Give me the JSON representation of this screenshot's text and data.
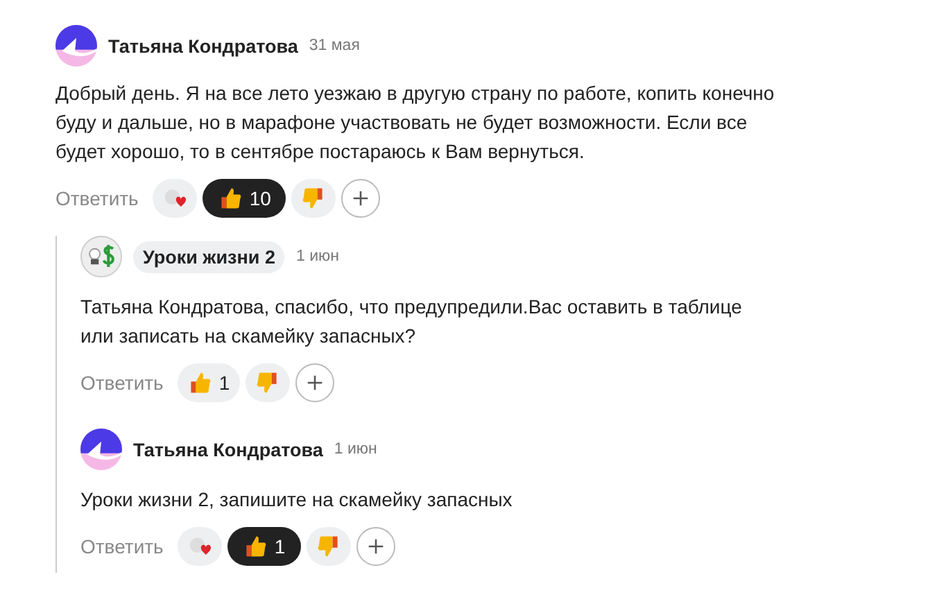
{
  "comments": [
    {
      "author": "Татьяна Кондратова",
      "author_highlighted": false,
      "avatar": {
        "kind": "brand"
      },
      "date": "31 мая",
      "text": "Добрый день. Я на все лето уезжаю в другую страну по работе, копить конечно буду и дальше, но в марафоне участвовать не будет возможности. Если все будет хорошо, то в сентябре постараюсь к Вам вернуться.",
      "reply_label": "Ответить",
      "reactions": [
        {
          "kind": "heart"
        },
        {
          "kind": "like",
          "selected": true,
          "count": "10"
        },
        {
          "kind": "dislike"
        },
        {
          "kind": "add"
        }
      ],
      "children": [
        {
          "author": "Уроки жизни 2",
          "author_highlighted": true,
          "avatar": {
            "kind": "money"
          },
          "date": "1 июн",
          "text": "Татьяна Кондратова, спасибо, что предупредили.Вас оставить в таблице или записать на скамейку запасных?",
          "reply_label": "Ответить",
          "reactions": [
            {
              "kind": "like",
              "selected": false,
              "count": "1"
            },
            {
              "kind": "dislike"
            },
            {
              "kind": "add"
            }
          ]
        },
        {
          "author": "Татьяна Кондратова",
          "author_highlighted": false,
          "avatar": {
            "kind": "brand"
          },
          "date": "1 июн",
          "text": "Уроки жизни 2, запишите на скамейку запасных",
          "reply_label": "Ответить",
          "reactions": [
            {
              "kind": "heart"
            },
            {
              "kind": "like",
              "selected": true,
              "count": "1"
            },
            {
              "kind": "dislike"
            },
            {
              "kind": "add"
            }
          ]
        }
      ]
    }
  ]
}
